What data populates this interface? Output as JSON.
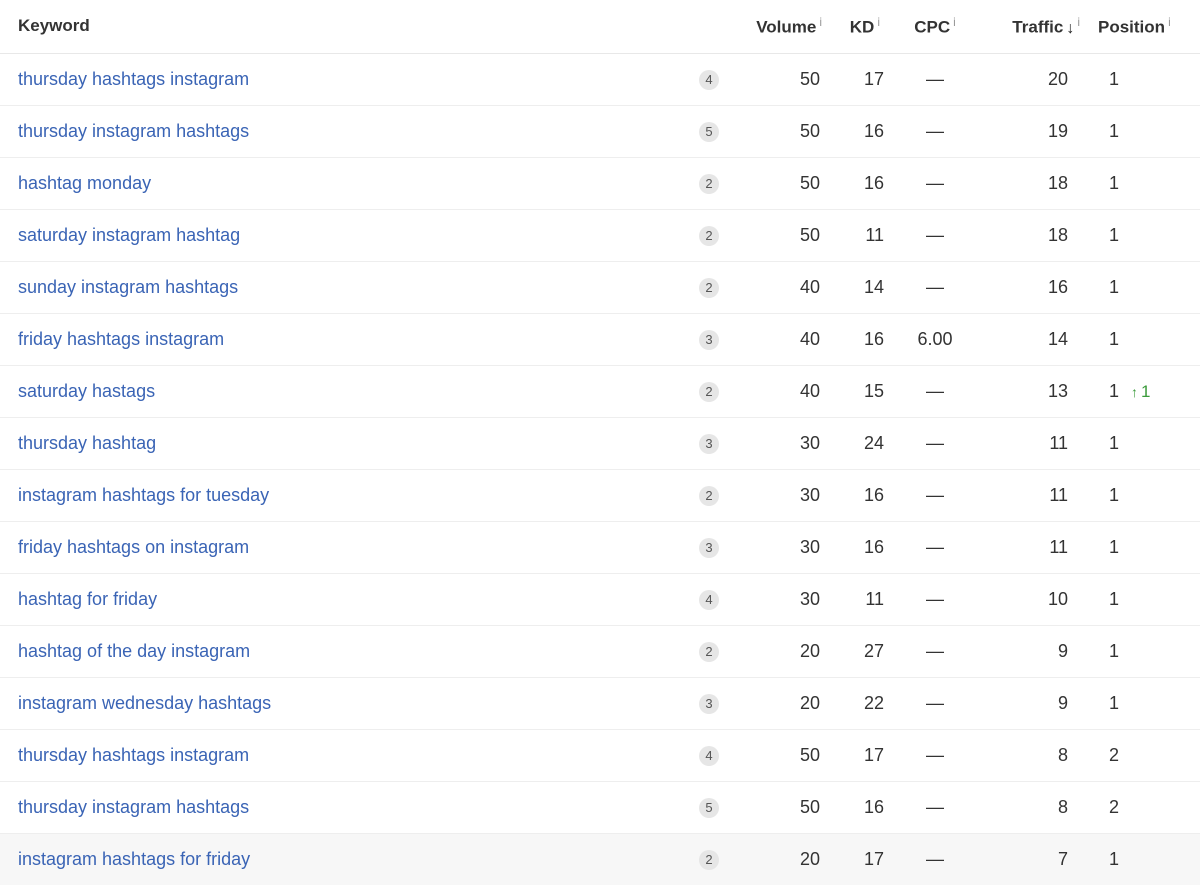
{
  "columns": {
    "keyword": "Keyword",
    "volume": "Volume",
    "kd": "KD",
    "cpc": "CPC",
    "traffic": "Traffic",
    "position": "Position"
  },
  "icons": {
    "info": "i",
    "sort_desc": "↓",
    "up_arrow": "↑"
  },
  "colors": {
    "link": "#3a64b5",
    "position_up": "#3c9b3c",
    "badge_bg": "#e6e6e6"
  },
  "rows": [
    {
      "keyword": "thursday hashtags instagram",
      "serp": "4",
      "volume": "50",
      "kd": "17",
      "cpc": "—",
      "traffic": "20",
      "position": "1",
      "change": ""
    },
    {
      "keyword": "thursday instagram hashtags",
      "serp": "5",
      "volume": "50",
      "kd": "16",
      "cpc": "—",
      "traffic": "19",
      "position": "1",
      "change": ""
    },
    {
      "keyword": "hashtag monday",
      "serp": "2",
      "volume": "50",
      "kd": "16",
      "cpc": "—",
      "traffic": "18",
      "position": "1",
      "change": ""
    },
    {
      "keyword": "saturday instagram hashtag",
      "serp": "2",
      "volume": "50",
      "kd": "11",
      "cpc": "—",
      "traffic": "18",
      "position": "1",
      "change": ""
    },
    {
      "keyword": "sunday instagram hashtags",
      "serp": "2",
      "volume": "40",
      "kd": "14",
      "cpc": "—",
      "traffic": "16",
      "position": "1",
      "change": ""
    },
    {
      "keyword": "friday hashtags instagram",
      "serp": "3",
      "volume": "40",
      "kd": "16",
      "cpc": "6.00",
      "traffic": "14",
      "position": "1",
      "change": ""
    },
    {
      "keyword": "saturday hastags",
      "serp": "2",
      "volume": "40",
      "kd": "15",
      "cpc": "—",
      "traffic": "13",
      "position": "1",
      "change": "1"
    },
    {
      "keyword": "thursday hashtag",
      "serp": "3",
      "volume": "30",
      "kd": "24",
      "cpc": "—",
      "traffic": "11",
      "position": "1",
      "change": ""
    },
    {
      "keyword": "instagram hashtags for tuesday",
      "serp": "2",
      "volume": "30",
      "kd": "16",
      "cpc": "—",
      "traffic": "11",
      "position": "1",
      "change": ""
    },
    {
      "keyword": "friday hashtags on instagram",
      "serp": "3",
      "volume": "30",
      "kd": "16",
      "cpc": "—",
      "traffic": "11",
      "position": "1",
      "change": ""
    },
    {
      "keyword": "hashtag for friday",
      "serp": "4",
      "volume": "30",
      "kd": "11",
      "cpc": "—",
      "traffic": "10",
      "position": "1",
      "change": ""
    },
    {
      "keyword": "hashtag of the day instagram",
      "serp": "2",
      "volume": "20",
      "kd": "27",
      "cpc": "—",
      "traffic": "9",
      "position": "1",
      "change": ""
    },
    {
      "keyword": "instagram wednesday hashtags",
      "serp": "3",
      "volume": "20",
      "kd": "22",
      "cpc": "—",
      "traffic": "9",
      "position": "1",
      "change": ""
    },
    {
      "keyword": "thursday hashtags instagram",
      "serp": "4",
      "volume": "50",
      "kd": "17",
      "cpc": "—",
      "traffic": "8",
      "position": "2",
      "change": ""
    },
    {
      "keyword": "thursday instagram hashtags",
      "serp": "5",
      "volume": "50",
      "kd": "16",
      "cpc": "—",
      "traffic": "8",
      "position": "2",
      "change": ""
    },
    {
      "keyword": "instagram hashtags for friday",
      "serp": "2",
      "volume": "20",
      "kd": "17",
      "cpc": "—",
      "traffic": "7",
      "position": "1",
      "change": ""
    }
  ]
}
